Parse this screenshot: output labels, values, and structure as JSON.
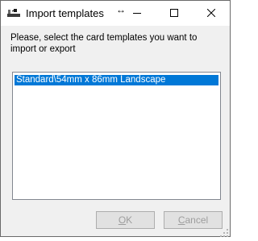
{
  "window": {
    "title": "Import templates",
    "resize_glyph": "↔",
    "icon": "card-templates-icon",
    "controls": [
      "minimize-icon",
      "maximize-icon",
      "close-icon"
    ]
  },
  "dialog": {
    "prompt": "Please, select the card templates you want to import or export",
    "templates": [
      {
        "label": "Standard\\54mm x 86mm Landscape",
        "selected": true
      }
    ]
  },
  "buttons": {
    "ok": {
      "mnemonic": "O",
      "rest": "K",
      "enabled": false
    },
    "cancel": {
      "mnemonic": "C",
      "rest": "ancel",
      "enabled": false
    }
  },
  "colors": {
    "selection": "#0078d7",
    "disabled_text": "#9d9d9d"
  }
}
